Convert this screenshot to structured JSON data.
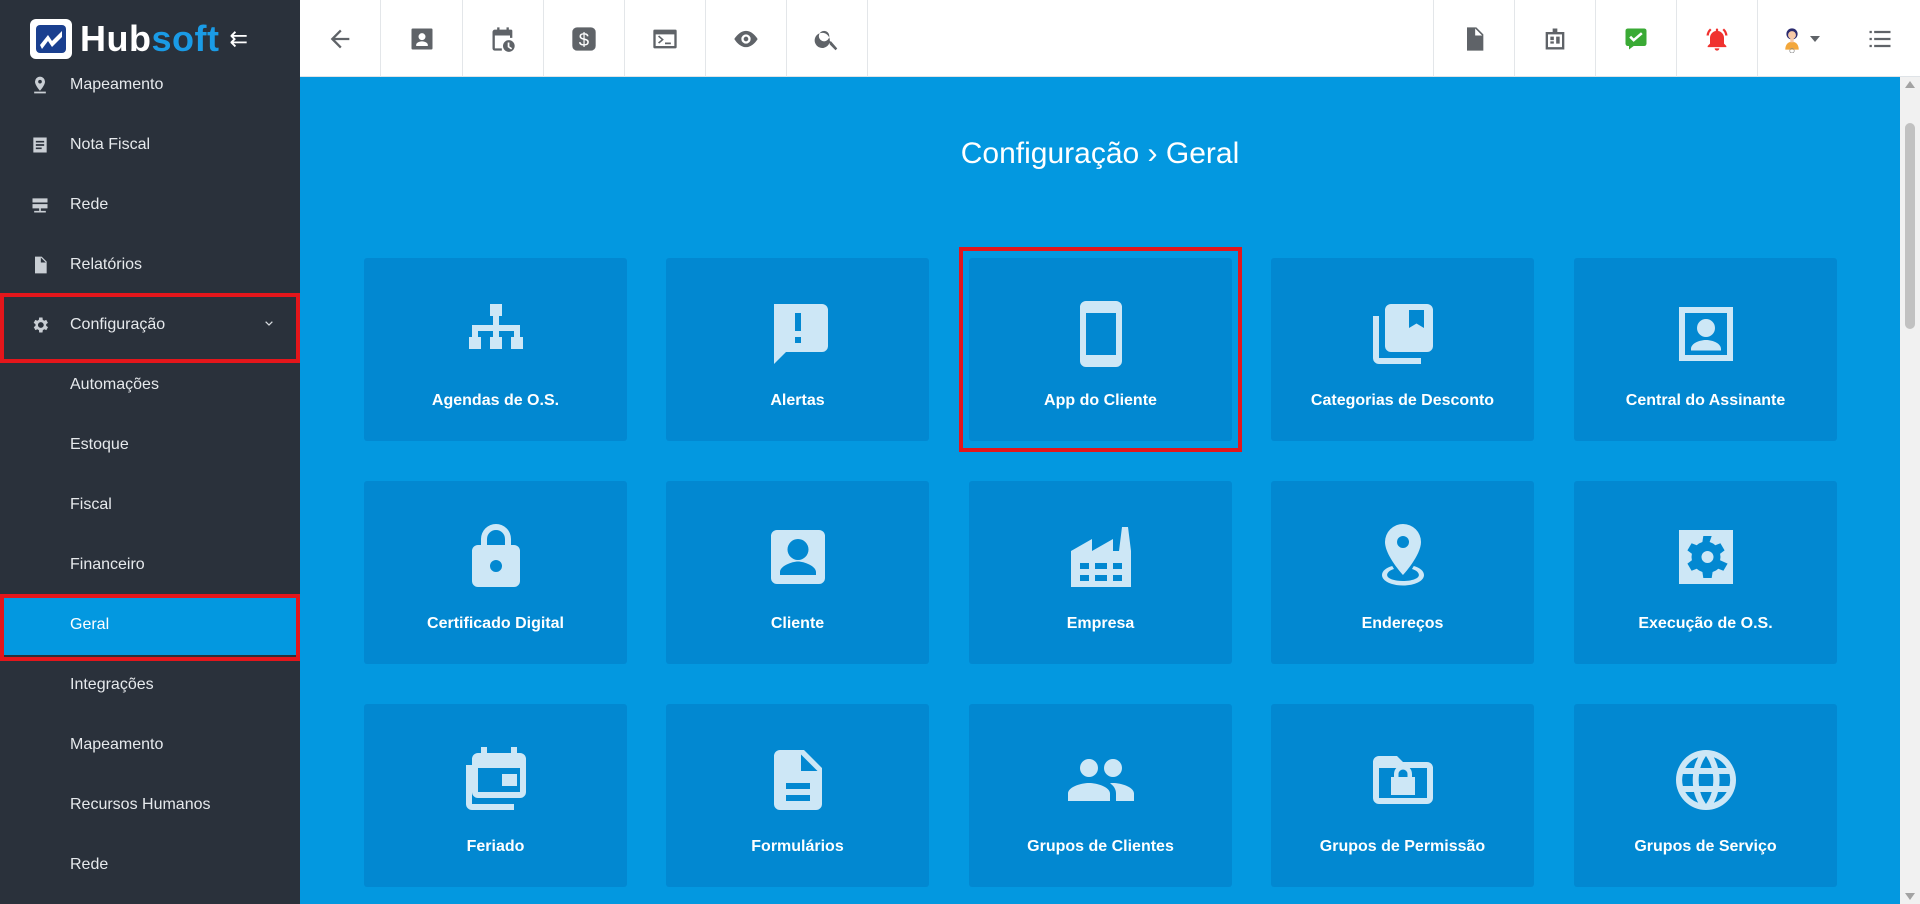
{
  "brand": {
    "name_part1": "Hub",
    "name_part2": "soft"
  },
  "sidebar": {
    "items": [
      {
        "label": "Mapeamento",
        "icon": "map-pin-icon"
      },
      {
        "label": "Nota Fiscal",
        "icon": "receipt-icon"
      },
      {
        "label": "Rede",
        "icon": "network-icon"
      },
      {
        "label": "Relatórios",
        "icon": "report-icon"
      },
      {
        "label": "Configuração",
        "icon": "gear-icon"
      }
    ],
    "subitems": [
      {
        "label": "Automações"
      },
      {
        "label": "Estoque"
      },
      {
        "label": "Fiscal"
      },
      {
        "label": "Financeiro"
      },
      {
        "label": "Geral"
      },
      {
        "label": "Integrações"
      },
      {
        "label": "Mapeamento"
      },
      {
        "label": "Recursos Humanos"
      },
      {
        "label": "Rede"
      }
    ]
  },
  "topbar": {
    "left_icons": [
      "back-arrow-icon",
      "contact-card-icon",
      "calendar-clock-icon",
      "dollar-icon",
      "terminal-icon",
      "eye-icon",
      "search-icon"
    ],
    "right_icons": [
      "pdf-icon",
      "id-badge-icon",
      "task-check-icon",
      "alarm-bell-icon",
      "user-avatar-icon",
      "list-menu-icon"
    ]
  },
  "page": {
    "breadcrumb_root": "Configuração",
    "breadcrumb_sep": "›",
    "breadcrumb_current": "Geral"
  },
  "tiles": [
    {
      "label": "Agendas de O.S.",
      "icon": "sitemap-icon"
    },
    {
      "label": "Alertas",
      "icon": "alert-message-icon"
    },
    {
      "label": "App do Cliente",
      "icon": "smartphone-icon"
    },
    {
      "label": "Categorias de Desconto",
      "icon": "bookmarks-icon"
    },
    {
      "label": "Central do Assinante",
      "icon": "portrait-icon"
    },
    {
      "label": "Certificado Digital",
      "icon": "lock-icon"
    },
    {
      "label": "Cliente",
      "icon": "account-box-icon"
    },
    {
      "label": "Empresa",
      "icon": "factory-icon"
    },
    {
      "label": "Endereços",
      "icon": "location-pin-icon"
    },
    {
      "label": "Execução de O.S.",
      "icon": "settings-box-icon"
    },
    {
      "label": "Feriado",
      "icon": "event-stack-icon"
    },
    {
      "label": "Formulários",
      "icon": "document-icon"
    },
    {
      "label": "Grupos de Clientes",
      "icon": "people-icon"
    },
    {
      "label": "Grupos de Permissão",
      "icon": "folder-lock-icon"
    },
    {
      "label": "Grupos de Serviço",
      "icon": "globe-icon"
    }
  ],
  "colors": {
    "sidebar_bg": "#2a313b",
    "accent": "#0398e0",
    "tile_bg": "#0288d1",
    "highlight": "#e4161b"
  }
}
